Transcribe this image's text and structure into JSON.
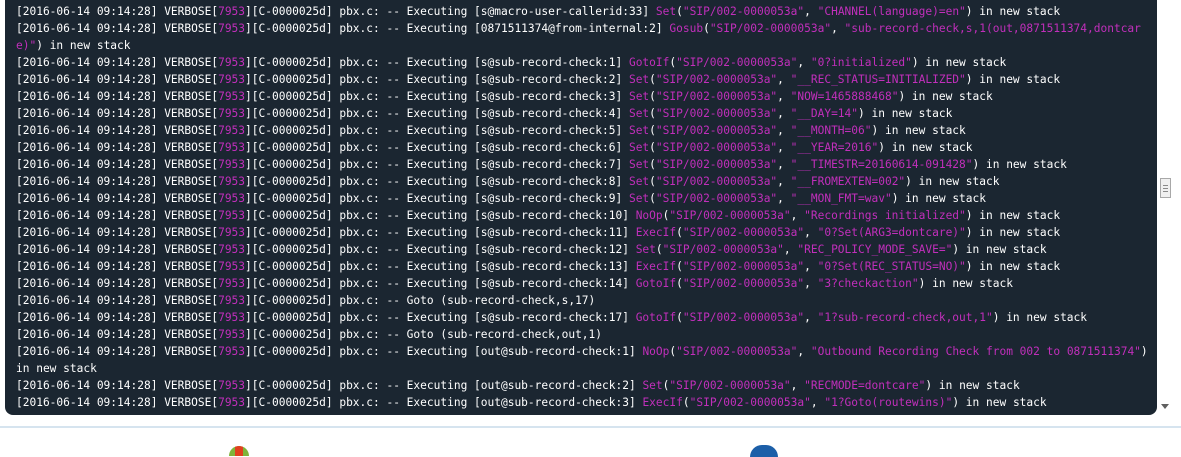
{
  "console": {
    "lines": [
      {
        "ts": "[2016-06-14 09:14:28]",
        "lvl": " VERBOSE[",
        "pid": "7953",
        "rest": "][C-0000025d] pbx.c: -- Executing [s@macro-user-callerid:33] ",
        "app": "Set",
        "open": "(",
        "args": [
          {
            "v": "\"SIP/002-0000053a\""
          },
          {
            "v": "\"CHANNEL(language)=en\""
          }
        ],
        "tail": ") in new stack"
      },
      {
        "ts": "[2016-06-14 09:14:28]",
        "lvl": " VERBOSE[",
        "pid": "7953",
        "rest": "][C-0000025d] pbx.c: -- Executing [0871511374@from-internal:2] ",
        "app": "Gosub",
        "open": "(",
        "args": [
          {
            "v": "\"SIP/002-0000053a\""
          },
          {
            "v": "\"sub-record-check,s,1(out,0871511374,dontcare)\""
          }
        ],
        "tail": ") in new stack"
      },
      {
        "ts": "[2016-06-14 09:14:28]",
        "lvl": " VERBOSE[",
        "pid": "7953",
        "rest": "][C-0000025d] pbx.c: -- Executing [s@sub-record-check:1] ",
        "app": "GotoIf",
        "open": "(",
        "args": [
          {
            "v": "\"SIP/002-0000053a\""
          },
          {
            "v": "\"0?initialized\""
          }
        ],
        "tail": ") in new stack"
      },
      {
        "ts": "[2016-06-14 09:14:28]",
        "lvl": " VERBOSE[",
        "pid": "7953",
        "rest": "][C-0000025d] pbx.c: -- Executing [s@sub-record-check:2] ",
        "app": "Set",
        "open": "(",
        "args": [
          {
            "v": "\"SIP/002-0000053a\""
          },
          {
            "v": "\"__REC_STATUS=INITIALIZED\""
          }
        ],
        "tail": ") in new stack"
      },
      {
        "ts": "[2016-06-14 09:14:28]",
        "lvl": " VERBOSE[",
        "pid": "7953",
        "rest": "][C-0000025d] pbx.c: -- Executing [s@sub-record-check:3] ",
        "app": "Set",
        "open": "(",
        "args": [
          {
            "v": "\"SIP/002-0000053a\""
          },
          {
            "v": "\"NOW=1465888468\""
          }
        ],
        "tail": ") in new stack"
      },
      {
        "ts": "[2016-06-14 09:14:28]",
        "lvl": " VERBOSE[",
        "pid": "7953",
        "rest": "][C-0000025d] pbx.c: -- Executing [s@sub-record-check:4] ",
        "app": "Set",
        "open": "(",
        "args": [
          {
            "v": "\"SIP/002-0000053a\""
          },
          {
            "v": "\"__DAY=14\""
          }
        ],
        "tail": ") in new stack"
      },
      {
        "ts": "[2016-06-14 09:14:28]",
        "lvl": " VERBOSE[",
        "pid": "7953",
        "rest": "][C-0000025d] pbx.c: -- Executing [s@sub-record-check:5] ",
        "app": "Set",
        "open": "(",
        "args": [
          {
            "v": "\"SIP/002-0000053a\""
          },
          {
            "v": "\"__MONTH=06\""
          }
        ],
        "tail": ") in new stack"
      },
      {
        "ts": "[2016-06-14 09:14:28]",
        "lvl": " VERBOSE[",
        "pid": "7953",
        "rest": "][C-0000025d] pbx.c: -- Executing [s@sub-record-check:6] ",
        "app": "Set",
        "open": "(",
        "args": [
          {
            "v": "\"SIP/002-0000053a\""
          },
          {
            "v": "\"__YEAR=2016\""
          }
        ],
        "tail": ") in new stack"
      },
      {
        "ts": "[2016-06-14 09:14:28]",
        "lvl": " VERBOSE[",
        "pid": "7953",
        "rest": "][C-0000025d] pbx.c: -- Executing [s@sub-record-check:7] ",
        "app": "Set",
        "open": "(",
        "args": [
          {
            "v": "\"SIP/002-0000053a\""
          },
          {
            "v": "\"__TIMESTR=20160614-091428\""
          }
        ],
        "tail": ") in new stack"
      },
      {
        "ts": "[2016-06-14 09:14:28]",
        "lvl": " VERBOSE[",
        "pid": "7953",
        "rest": "][C-0000025d] pbx.c: -- Executing [s@sub-record-check:8] ",
        "app": "Set",
        "open": "(",
        "args": [
          {
            "v": "\"SIP/002-0000053a\""
          },
          {
            "v": "\"__FROMEXTEN=002\""
          }
        ],
        "tail": ") in new stack"
      },
      {
        "ts": "[2016-06-14 09:14:28]",
        "lvl": " VERBOSE[",
        "pid": "7953",
        "rest": "][C-0000025d] pbx.c: -- Executing [s@sub-record-check:9] ",
        "app": "Set",
        "open": "(",
        "args": [
          {
            "v": "\"SIP/002-0000053a\""
          },
          {
            "v": "\"__MON_FMT=wav\""
          }
        ],
        "tail": ") in new stack"
      },
      {
        "ts": "[2016-06-14 09:14:28]",
        "lvl": " VERBOSE[",
        "pid": "7953",
        "rest": "][C-0000025d] pbx.c: -- Executing [s@sub-record-check:10] ",
        "app": "NoOp",
        "open": "(",
        "args": [
          {
            "v": "\"SIP/002-0000053a\""
          },
          {
            "v": "\"Recordings initialized\""
          }
        ],
        "tail": ") in new stack"
      },
      {
        "ts": "[2016-06-14 09:14:28]",
        "lvl": " VERBOSE[",
        "pid": "7953",
        "rest": "][C-0000025d] pbx.c: -- Executing [s@sub-record-check:11] ",
        "app": "ExecIf",
        "open": "(",
        "args": [
          {
            "v": "\"SIP/002-0000053a\""
          },
          {
            "v": "\"0?Set(ARG3=dontcare)\""
          }
        ],
        "tail": ") in new stack"
      },
      {
        "ts": "[2016-06-14 09:14:28]",
        "lvl": " VERBOSE[",
        "pid": "7953",
        "rest": "][C-0000025d] pbx.c: -- Executing [s@sub-record-check:12] ",
        "app": "Set",
        "open": "(",
        "args": [
          {
            "v": "\"SIP/002-0000053a\""
          },
          {
            "v": "\"REC_POLICY_MODE_SAVE=\""
          }
        ],
        "tail": ") in new stack"
      },
      {
        "ts": "[2016-06-14 09:14:28]",
        "lvl": " VERBOSE[",
        "pid": "7953",
        "rest": "][C-0000025d] pbx.c: -- Executing [s@sub-record-check:13] ",
        "app": "ExecIf",
        "open": "(",
        "args": [
          {
            "v": "\"SIP/002-0000053a\""
          },
          {
            "v": "\"0?Set(REC_STATUS=NO)\""
          }
        ],
        "tail": ") in new stack"
      },
      {
        "ts": "[2016-06-14 09:14:28]",
        "lvl": " VERBOSE[",
        "pid": "7953",
        "rest": "][C-0000025d] pbx.c: -- Executing [s@sub-record-check:14] ",
        "app": "GotoIf",
        "open": "(",
        "args": [
          {
            "v": "\"SIP/002-0000053a\""
          },
          {
            "v": "\"3?checkaction\""
          }
        ],
        "tail": ") in new stack"
      },
      {
        "ts": "[2016-06-14 09:14:28]",
        "lvl": " VERBOSE[",
        "pid": "7953",
        "rest": "][C-0000025d] pbx.c: -- Goto (sub-record-check,s,17)",
        "app": "",
        "open": "",
        "args": [],
        "tail": ""
      },
      {
        "ts": "[2016-06-14 09:14:28]",
        "lvl": " VERBOSE[",
        "pid": "7953",
        "rest": "][C-0000025d] pbx.c: -- Executing [s@sub-record-check:17] ",
        "app": "GotoIf",
        "open": "(",
        "args": [
          {
            "v": "\"SIP/002-0000053a\""
          },
          {
            "v": "\"1?sub-record-check,out,1\""
          }
        ],
        "tail": ") in new stack"
      },
      {
        "ts": "[2016-06-14 09:14:28]",
        "lvl": " VERBOSE[",
        "pid": "7953",
        "rest": "][C-0000025d] pbx.c: -- Goto (sub-record-check,out,1)",
        "app": "",
        "open": "",
        "args": [],
        "tail": ""
      },
      {
        "ts": "[2016-06-14 09:14:28]",
        "lvl": " VERBOSE[",
        "pid": "7953",
        "rest": "][C-0000025d] pbx.c: -- Executing [out@sub-record-check:1] ",
        "app": "NoOp",
        "open": "(",
        "args": [
          {
            "v": "\"SIP/002-0000053a\""
          },
          {
            "v": "\"Outbound Recording Check from 002 to 0871511374\""
          }
        ],
        "tail": ") in new stack"
      },
      {
        "ts": "[2016-06-14 09:14:28]",
        "lvl": " VERBOSE[",
        "pid": "7953",
        "rest": "][C-0000025d] pbx.c: -- Executing [out@sub-record-check:2] ",
        "app": "Set",
        "open": "(",
        "args": [
          {
            "v": "\"SIP/002-0000053a\""
          },
          {
            "v": "\"RECMODE=dontcare\""
          }
        ],
        "tail": ") in new stack"
      },
      {
        "ts": "[2016-06-14 09:14:28]",
        "lvl": " VERBOSE[",
        "pid": "7953",
        "rest": "][C-0000025d] pbx.c: -- Executing [out@sub-record-check:3] ",
        "app": "ExecIf",
        "open": "(",
        "args": [
          {
            "v": "\"SIP/002-0000053a\""
          },
          {
            "v": "\"1?Goto(routewins)\""
          }
        ],
        "tail": ") in new stack"
      }
    ]
  },
  "colors": {
    "console_bg": "#1b2631",
    "text": "#ffffff",
    "highlight": "#c12fbb"
  },
  "icons": {
    "scroll_down": "scroll-down-arrow-icon",
    "taskbar_left": "app-icon",
    "taskbar_right": "app-icon"
  }
}
